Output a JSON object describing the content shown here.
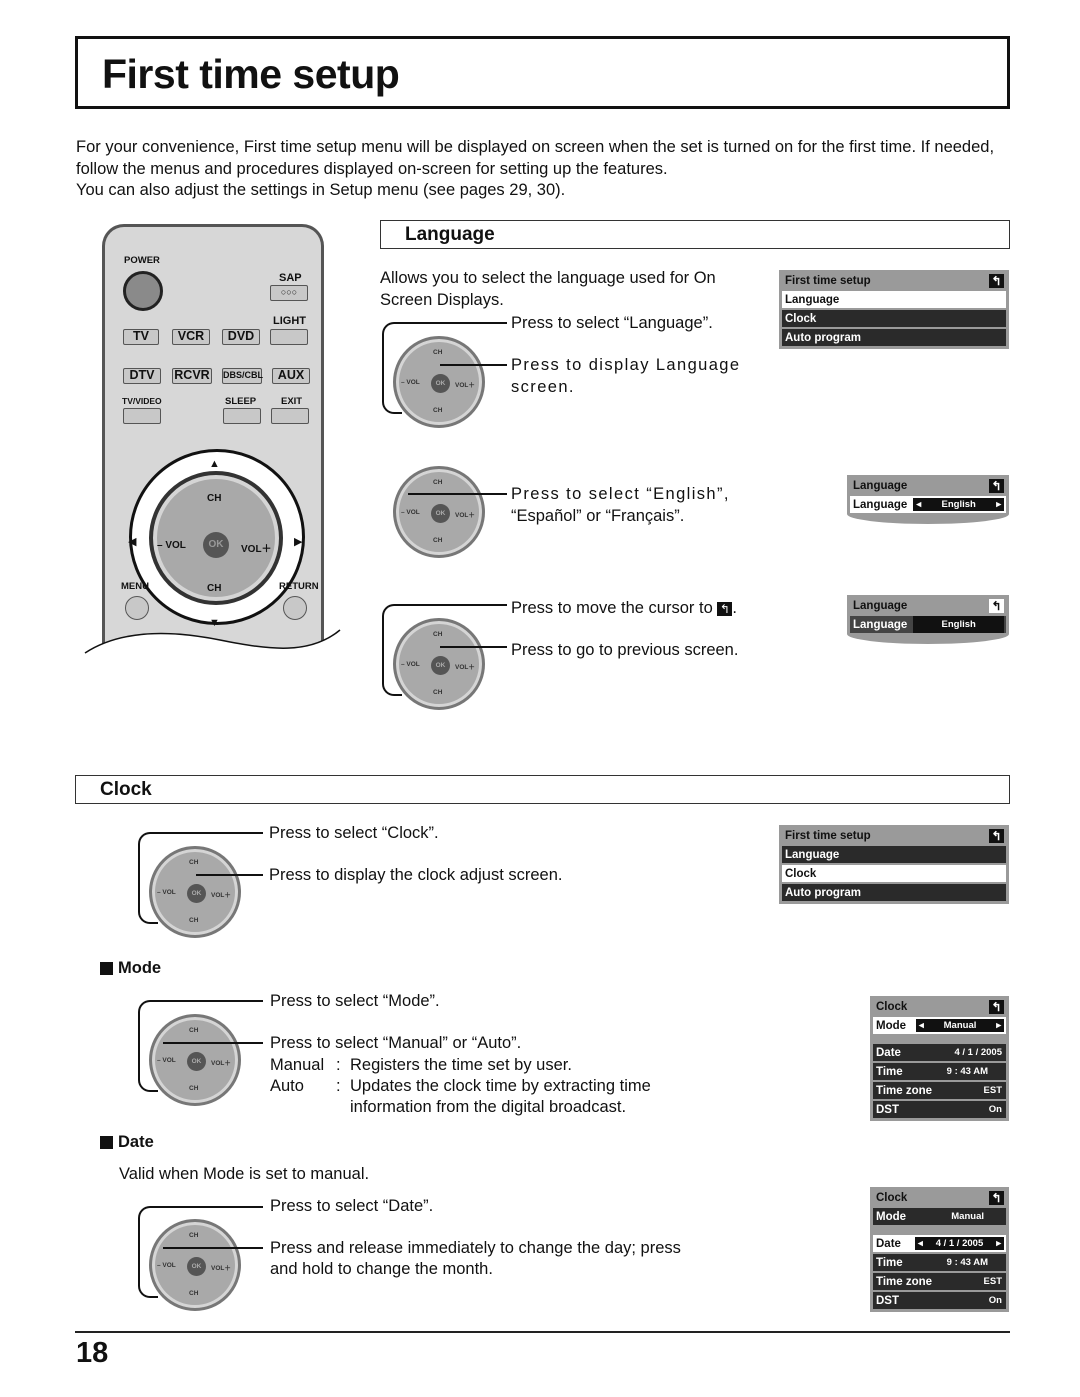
{
  "page": {
    "title": "First time setup",
    "intro": [
      "For your convenience, First time setup menu will be displayed on screen when the set is turned on for the first time. If needed, follow the menus and procedures displayed on-screen for setting up the features.",
      "You can also adjust the settings in Setup menu (see pages 29, 30)."
    ],
    "page_number": "18"
  },
  "remote": {
    "power": "POWER",
    "sap": "SAP",
    "sap_dots": "○○○",
    "light": "LIGHT",
    "row1": [
      "TV",
      "VCR",
      "DVD"
    ],
    "row2": [
      "DTV",
      "RCVR",
      "DBS/CBL",
      "AUX"
    ],
    "tv_video": "TV/VIDEO",
    "sleep": "SLEEP",
    "exit": "EXIT",
    "ch": "CH",
    "vol_minus": "– VOL",
    "vol_plus": "VOL＋",
    "ok": "OK",
    "menu": "MENU",
    "return": "RETURN",
    "arrow_up": "▲",
    "arrow_down": "▼",
    "arrow_left": "◀",
    "arrow_right": "▶"
  },
  "pad": {
    "ch": "CH",
    "vol_minus": "– VOL",
    "vol_plus": "VOL＋",
    "ok": "OK",
    "up": "^",
    "down": "v"
  },
  "language": {
    "heading": "Language",
    "desc": "Allows you to select the language used for On Screen Displays.",
    "step1": {
      "a": "Press to select “Language”.",
      "b": "Press to display Language screen."
    },
    "step2": {
      "a": "Press to select “English”,",
      "b": "“Español” or “Français”."
    },
    "step3": {
      "a": "Press to move  the cursor to",
      "a_end": ".",
      "b": "Press to go to previous screen."
    },
    "osd_main": {
      "title": "First time setup",
      "items": [
        "Language",
        "Clock",
        "Auto program"
      ],
      "selected": 0
    },
    "osd_lang1": {
      "title": "Language",
      "label": "Language",
      "value": "English"
    },
    "osd_lang2": {
      "title": "Language",
      "label": "Language",
      "value": "English"
    }
  },
  "clock": {
    "heading": "Clock",
    "step1": {
      "a": "Press to select “Clock”.",
      "b": "Press to display the clock adjust screen."
    },
    "osd_main": {
      "title": "First time setup",
      "items": [
        "Language",
        "Clock",
        "Auto program"
      ],
      "selected": 1
    },
    "mode": {
      "heading": "Mode",
      "a": "Press to select “Mode”.",
      "b": "Press to select “Manual” or “Auto”.",
      "manual_key": "Manual",
      "manual_desc": "Registers the time set by user.",
      "auto_key": "Auto",
      "auto_desc1": "Updates the clock time by extracting time",
      "auto_desc2": "information from the digital broadcast.",
      "colon": ":"
    },
    "date": {
      "heading": "Date",
      "valid": "Valid when Mode is set to manual.",
      "a": "Press to select “Date”.",
      "b1": "Press and release immediately to change the day; press",
      "b2": "and hold to change the month."
    },
    "osd_clock": {
      "title": "Clock",
      "mode_label": "Mode",
      "mode_value": "Manual",
      "rows": [
        {
          "label": "Date",
          "value": "4 / 1 / 2005"
        },
        {
          "label": "Time",
          "value": "9 : 43 AM"
        },
        {
          "label": "Time zone",
          "value": "EST"
        },
        {
          "label": "DST",
          "value": "On"
        }
      ]
    }
  },
  "icons": {
    "return": "↰",
    "left": "◂",
    "right": "▸"
  }
}
